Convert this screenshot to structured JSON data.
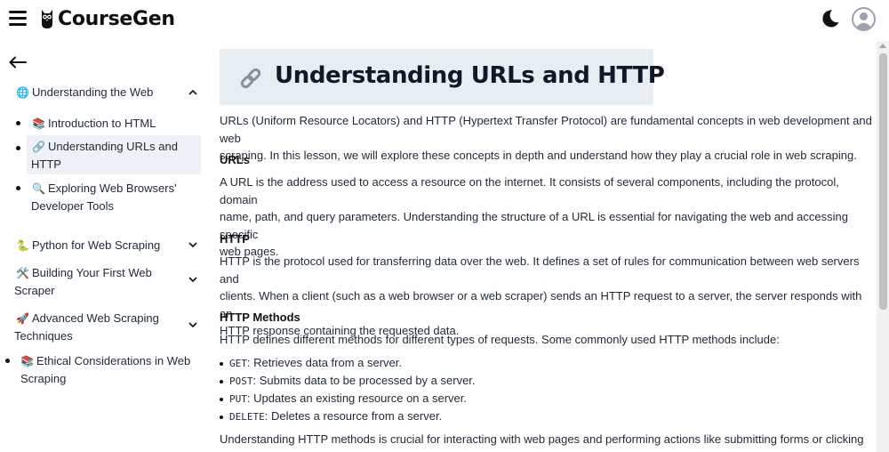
{
  "header": {
    "app_name": "CourseGen",
    "menu_icon": "hamburger-menu-icon",
    "logo_icon": "owl-icon",
    "theme_icon": "moon-icon",
    "avatar_icon": "user-avatar-icon"
  },
  "sidebar": {
    "back_icon": "arrow-left-icon",
    "sections": [
      {
        "emoji": "🌐",
        "label": "Understanding the Web",
        "expanded": true,
        "items": [
          {
            "emoji": "📚",
            "label": "Introduction to HTML"
          },
          {
            "emoji": "🔗",
            "label_line1": "Understanding URLs and",
            "label_line2": "HTTP",
            "active": true
          },
          {
            "emoji": "🔍",
            "label_line1": "Exploring Web Browsers'",
            "label_line2": "Developer Tools"
          }
        ]
      },
      {
        "emoji": "🐍",
        "label": "Python for Web Scraping",
        "expanded": false
      },
      {
        "emoji": "🛠️",
        "label_line1": "Building Your First Web",
        "label_line2": "Scraper",
        "expanded": false
      },
      {
        "emoji": "🚀",
        "label_line1": "Advanced Web Scraping",
        "label_line2": "Techniques",
        "expanded": false
      },
      {
        "emoji": "📚",
        "label_line1": "Ethical Considerations in Web",
        "label_line2": "Scraping"
      }
    ]
  },
  "main": {
    "title_icon": "link-icon",
    "title": "Understanding URLs and HTTP",
    "intro_l1": "URLs (Uniform Resource Locators) and HTTP (Hypertext Transfer Protocol) are fundamental concepts in web development and web",
    "intro_l2": "scraping. In this lesson, we will explore these concepts in depth and understand how they play a crucial role in web scraping.",
    "h_urls": "URLs",
    "urls_l1": "A URL is the address used to access a resource on the internet. It consists of several components, including the protocol, domain",
    "urls_l2": "name, path, and query parameters. Understanding the structure of a URL is essential for navigating the web and accessing specific",
    "urls_l3": "web pages.",
    "h_http": "HTTP",
    "http_l1": "HTTP is the protocol used for transferring data over the web. It defines a set of rules for communication between web servers and",
    "http_l2": "clients. When a client (such as a web browser or a web scraper) sends an HTTP request to a server, the server responds with an",
    "http_l3": "HTTP response containing the requested data.",
    "h_methods": "HTTP Methods",
    "methods_intro": "HTTP defines different methods for different types of requests. Some commonly used HTTP methods include:",
    "methods": [
      {
        "code": "GET",
        "desc": ": Retrieves data from a server."
      },
      {
        "code": "POST",
        "desc": ": Submits data to be processed by a server."
      },
      {
        "code": "PUT",
        "desc": ": Updates an existing resource on a server."
      },
      {
        "code": "DELETE",
        "desc": ": Deletes a resource from a server."
      }
    ],
    "outro_l1": "Understanding HTTP methods is crucial for interacting with web pages and performing actions like submitting forms or clicking"
  }
}
